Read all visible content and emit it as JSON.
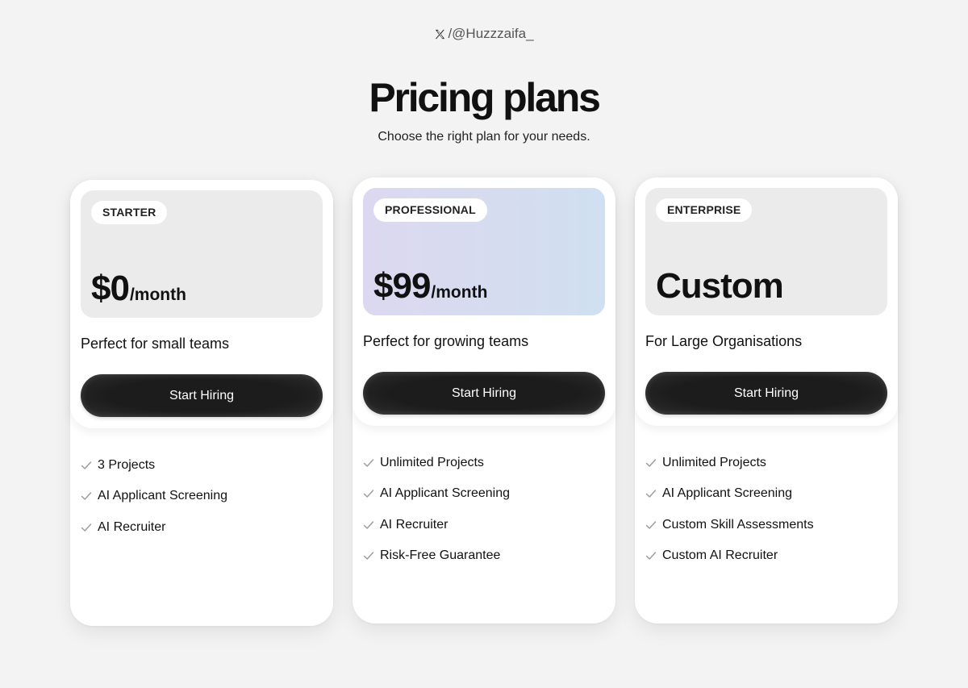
{
  "header": {
    "x_icon": "x-logo-icon",
    "handle": "/@Huzzzaifa_",
    "title": "Pricing plans",
    "subtitle": "Choose the right plan for your needs."
  },
  "colors": {
    "background": "#f3f3f3",
    "card": "#ffffff",
    "panel_default": "#ebebeb",
    "panel_professional_gradient": [
      "#dcd8f0",
      "#cfe0f0"
    ],
    "button": "#1c1c1c",
    "check": "#9a9a9a"
  },
  "plans": [
    {
      "badge": "STARTER",
      "amount": "$0",
      "period": "/month",
      "tagline": "Perfect for small teams",
      "cta": "Start Hiring",
      "features": [
        "3 Projects",
        "AI Applicant Screening",
        "AI Recruiter"
      ]
    },
    {
      "badge": "PROFESSIONAL",
      "amount": "$99",
      "period": "/month",
      "tagline": "Perfect for growing teams",
      "cta": "Start Hiring",
      "features": [
        "Unlimited Projects",
        "AI Applicant Screening",
        "AI Recruiter",
        "Risk-Free Guarantee"
      ]
    },
    {
      "badge": "ENTERPRISE",
      "amount": "Custom",
      "period": "",
      "tagline": "For Large Organisations",
      "cta": "Start Hiring",
      "features": [
        "Unlimited Projects",
        "AI Applicant Screening",
        "Custom Skill Assessments",
        "Custom AI Recruiter"
      ]
    }
  ]
}
